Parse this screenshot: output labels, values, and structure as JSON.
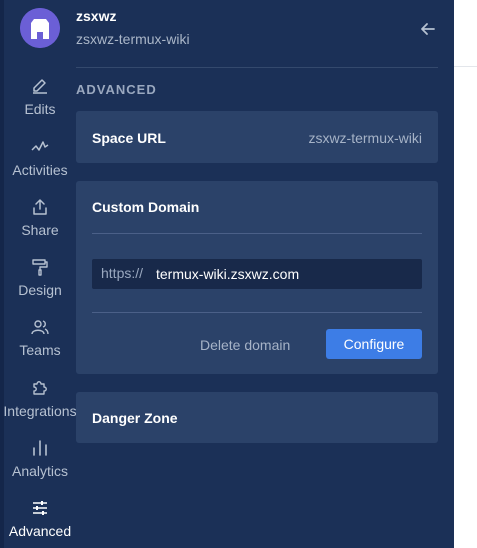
{
  "space": {
    "name": "zsxwz",
    "slug": "zsxwz-termux-wiki"
  },
  "nav": [
    {
      "id": "edits",
      "label": "Edits",
      "icon": "pencil-icon"
    },
    {
      "id": "activities",
      "label": "Activities",
      "icon": "activity-icon"
    },
    {
      "id": "share",
      "label": "Share",
      "icon": "share-icon"
    },
    {
      "id": "design",
      "label": "Design",
      "icon": "paint-roller-icon"
    },
    {
      "id": "teams",
      "label": "Teams",
      "icon": "users-icon"
    },
    {
      "id": "integrations",
      "label": "Integrations",
      "icon": "puzzle-icon"
    },
    {
      "id": "analytics",
      "label": "Analytics",
      "icon": "bar-chart-icon"
    },
    {
      "id": "advanced",
      "label": "Advanced",
      "icon": "sliders-icon",
      "active": true
    }
  ],
  "main": {
    "section_title": "ADVANCED",
    "space_url": {
      "label": "Space URL",
      "value": "zsxwz-termux-wiki"
    },
    "custom_domain": {
      "label": "Custom Domain",
      "prefix": "https://",
      "value": "termux-wiki.zsxwz.com",
      "delete_label": "Delete domain",
      "configure_label": "Configure"
    },
    "danger_zone": {
      "label": "Danger Zone"
    }
  },
  "colors": {
    "sidebar": "#1b3057",
    "card": "#2b4269",
    "accent": "#3d7de6"
  }
}
